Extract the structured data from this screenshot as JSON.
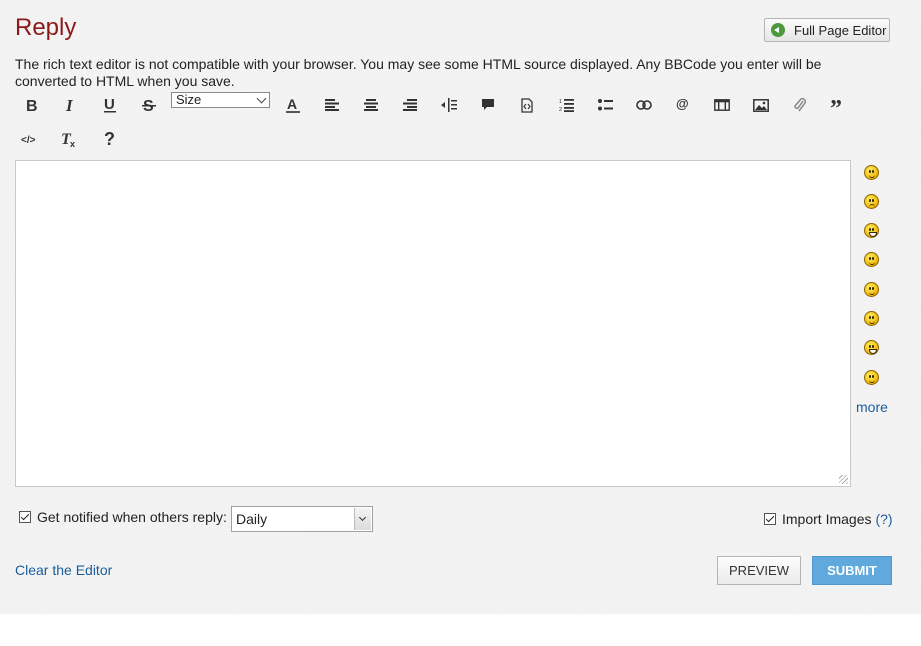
{
  "header": {
    "title": "Reply",
    "full_page_label": "Full Page Editor"
  },
  "notice": "The rich text editor is not compatible with your browser. You may see some HTML source displayed. Any BBCode you enter will be converted to HTML when you save.",
  "toolbar": {
    "size_select_value": "Size",
    "tools": [
      "bold",
      "italic",
      "underline",
      "strikethrough",
      "size",
      "font-color",
      "align-left",
      "align-center",
      "align-right",
      "indent",
      "spoiler",
      "source",
      "numbered-list",
      "bulleted-list",
      "link",
      "mention",
      "media",
      "image",
      "attachment",
      "quote",
      "code",
      "clear-formatting",
      "help"
    ]
  },
  "smilies": {
    "items": [
      "smile",
      "sad",
      "grin",
      "wink",
      "happy",
      "tongue",
      "laugh",
      "cool"
    ],
    "more_label": "more"
  },
  "footer": {
    "notify_label": "Get notified when others reply:",
    "notify_frequency": "Daily",
    "import_images_label": "Import Images",
    "import_help_label": "(?)",
    "clear_label": "Clear the Editor",
    "preview_label": "PREVIEW",
    "submit_label": "SUBMIT"
  },
  "colors": {
    "title": "#8b1a1a",
    "link": "#1a5c9a",
    "submit_bg": "#5fa9dd"
  }
}
